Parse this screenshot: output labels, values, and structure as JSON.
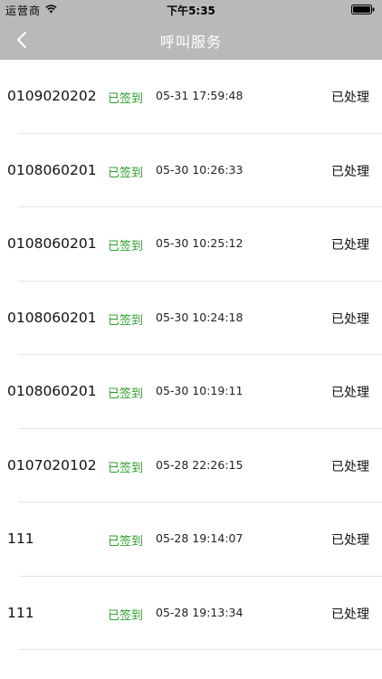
{
  "status_bar": {
    "carrier": "运营商",
    "time": "下午5:35"
  },
  "nav": {
    "title": "呼叫服务"
  },
  "rows": [
    {
      "id": "0109020202",
      "status": "已签到",
      "time": "05-31 17:59:48",
      "result": "已处理"
    },
    {
      "id": "0108060201",
      "status": "已签到",
      "time": "05-30 10:26:33",
      "result": "已处理"
    },
    {
      "id": "0108060201",
      "status": "已签到",
      "time": "05-30 10:25:12",
      "result": "已处理"
    },
    {
      "id": "0108060201",
      "status": "已签到",
      "time": "05-30 10:24:18",
      "result": "已处理"
    },
    {
      "id": "0108060201",
      "status": "已签到",
      "time": "05-30 10:19:11",
      "result": "已处理"
    },
    {
      "id": "0107020102",
      "status": "已签到",
      "time": "05-28 22:26:15",
      "result": "已处理"
    },
    {
      "id": "111",
      "status": "已签到",
      "time": "05-28 19:14:07",
      "result": "已处理"
    },
    {
      "id": "111",
      "status": "已签到",
      "time": "05-28 19:13:34",
      "result": "已处理"
    }
  ],
  "colors": {
    "header_bg": "#b9b9b9",
    "status_green": "#2aa22a",
    "title_text": "#ffffff"
  },
  "icons": {
    "wifi": "wifi-icon",
    "battery": "battery-icon",
    "back": "chevron-left-icon"
  }
}
